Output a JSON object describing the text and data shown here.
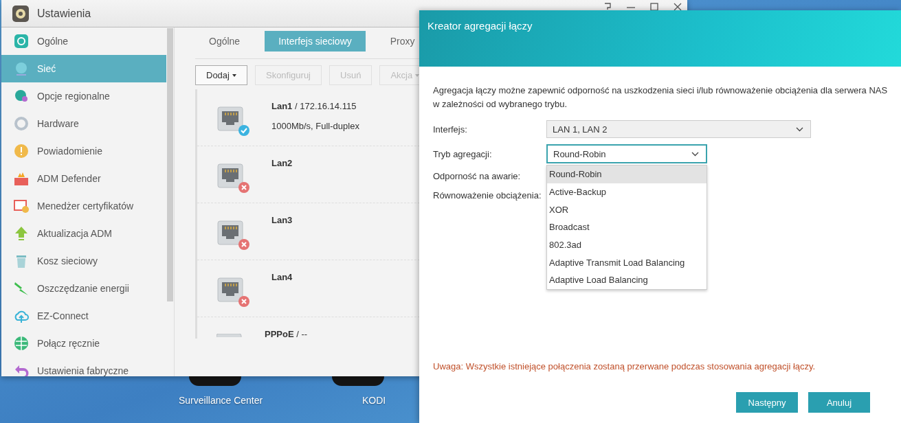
{
  "desktop": {
    "icons": [
      {
        "label": "Surveillance Center"
      },
      {
        "label": "KODI"
      }
    ]
  },
  "settings_window": {
    "title": "Ustawienia",
    "sidebar": {
      "items": [
        {
          "label": "Ogólne",
          "selected": false
        },
        {
          "label": "Sieć",
          "selected": true
        },
        {
          "label": "Opcje regionalne",
          "selected": false
        },
        {
          "label": "Hardware",
          "selected": false
        },
        {
          "label": "Powiadomienie",
          "selected": false
        },
        {
          "label": "ADM Defender",
          "selected": false
        },
        {
          "label": "Menedżer certyfikatów",
          "selected": false
        },
        {
          "label": "Aktualizacja ADM",
          "selected": false
        },
        {
          "label": "Kosz sieciowy",
          "selected": false
        },
        {
          "label": "Oszczędzanie energii",
          "selected": false
        },
        {
          "label": "EZ-Connect",
          "selected": false
        },
        {
          "label": "Połącz ręcznie",
          "selected": false
        },
        {
          "label": "Ustawienia fabryczne",
          "selected": false
        }
      ]
    },
    "tabs": [
      {
        "label": "Ogólne",
        "selected": false
      },
      {
        "label": "Interfejs sieciowy",
        "selected": true
      },
      {
        "label": "Proxy",
        "selected": false
      }
    ],
    "toolbar": [
      {
        "label": "Dodaj",
        "disabled": false,
        "caret": true
      },
      {
        "label": "Skonfiguruj",
        "disabled": true,
        "caret": false
      },
      {
        "label": "Usuń",
        "disabled": true,
        "caret": false
      },
      {
        "label": "Akcja",
        "disabled": true,
        "caret": true
      }
    ],
    "interfaces": [
      {
        "name": "Lan1",
        "detail": "/ 172.16.14.115",
        "speed": "1000Mb/s, Full-duplex",
        "kind": "lan",
        "connected": true
      },
      {
        "name": "Lan2",
        "kind": "lan",
        "connected": false
      },
      {
        "name": "Lan3",
        "kind": "lan",
        "connected": false
      },
      {
        "name": "Lan4",
        "kind": "lan",
        "connected": false
      },
      {
        "name": "PPPoE",
        "detail": "/ --",
        "kind": "pppoe"
      }
    ]
  },
  "dialog": {
    "title": "Kreator agregacji łączy",
    "description": "Agregacja łączy możne zapewnić odporność na uszkodzenia sieci i/lub równoważenie obciążenia dla serwera NAS w zależności od wybranego trybu.",
    "fields": [
      {
        "label": "Interfejs:",
        "value": "LAN 1, LAN 2",
        "kind": "select",
        "focused": false
      },
      {
        "label": "Tryb agregacji:",
        "value": "Round-Robin",
        "kind": "select",
        "focused": true
      },
      {
        "label": "Odporność na awarie:",
        "kind": "text"
      },
      {
        "label": "Równoważenie obciążenia:",
        "kind": "text"
      }
    ],
    "dropdown_options": [
      {
        "label": "Round-Robin",
        "selected": true
      },
      {
        "label": "Active-Backup",
        "selected": false
      },
      {
        "label": "XOR",
        "selected": false
      },
      {
        "label": "Broadcast",
        "selected": false
      },
      {
        "label": "802.3ad",
        "selected": false
      },
      {
        "label": "Adaptive Transmit Load Balancing",
        "selected": false
      },
      {
        "label": "Adaptive Load Balancing",
        "selected": false
      }
    ],
    "warning": "Uwaga: Wszystkie istniejące połączenia zostaną przerwane podczas stosowania agregacji łączy.",
    "buttons": [
      "Następny",
      "Anuluj"
    ]
  }
}
